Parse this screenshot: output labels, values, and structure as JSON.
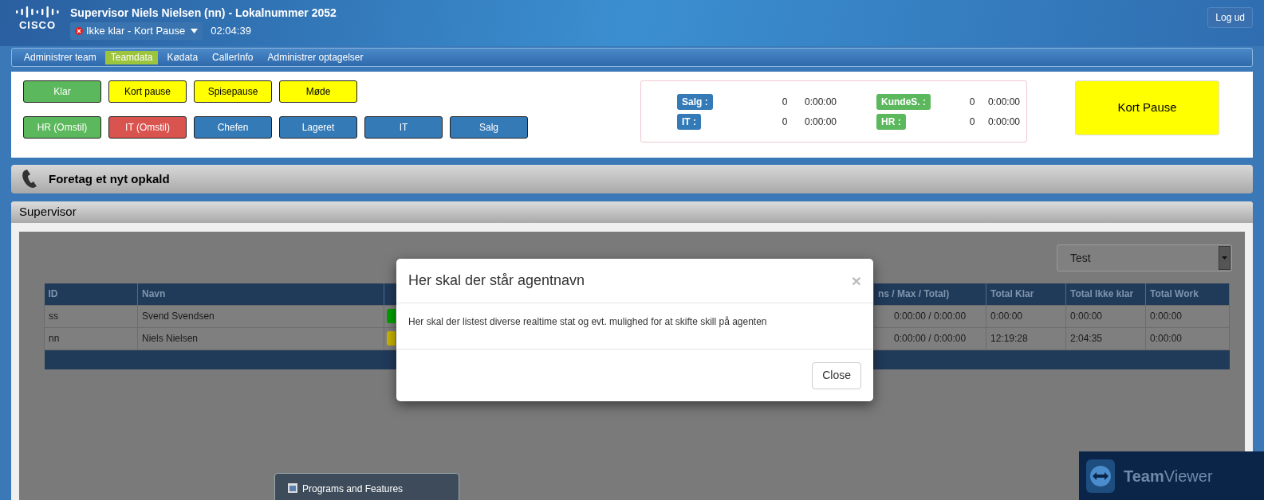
{
  "header": {
    "logo": "CISCO",
    "title": "Supervisor Niels Nielsen (nn) - Lokalnummer 2052",
    "status": "Ikke klar - Kort Pause",
    "timer": "02:04:39",
    "logout": "Log ud"
  },
  "nav": [
    {
      "label": "Administrer team",
      "selected": false
    },
    {
      "label": "Teamdata",
      "selected": true
    },
    {
      "label": "Kødata",
      "selected": false
    },
    {
      "label": "CallerInfo",
      "selected": false
    },
    {
      "label": "Administrer optagelser",
      "selected": false
    }
  ],
  "state_buttons": [
    [
      {
        "label": "Klar",
        "color": "#5cb85c"
      },
      {
        "label": "Kort pause",
        "color": "#ffff00"
      },
      {
        "label": "Spisepause",
        "color": "#ffff00"
      },
      {
        "label": "Møde",
        "color": "#ffff00"
      }
    ],
    [
      {
        "label": "HR (Omstil)",
        "color": "#5cb85c"
      },
      {
        "label": "IT (Omstil)",
        "color": "#d9534f"
      },
      {
        "label": "Chefen",
        "color": "#337ab7"
      },
      {
        "label": "Lageret",
        "color": "#337ab7"
      },
      {
        "label": "IT",
        "color": "#337ab7"
      },
      {
        "label": "Salg",
        "color": "#337ab7"
      }
    ]
  ],
  "queues": [
    {
      "label": "Salg :",
      "color": "#337ab7",
      "count": "0",
      "time": "0:00:00"
    },
    {
      "label": "KundeS. :",
      "color": "#5cb85c",
      "count": "0",
      "time": "0:00:00"
    },
    {
      "label": "IT :",
      "color": "#337ab7",
      "count": "0",
      "time": "0:00:00"
    },
    {
      "label": "HR :",
      "color": "#5cb85c",
      "count": "0",
      "time": "0:00:00"
    }
  ],
  "current_state": "Kort Pause",
  "call_bar": {
    "title": "Foretag et nyt opkald"
  },
  "supervisor": {
    "title": "Supervisor",
    "team_select": "Test",
    "columns": [
      {
        "kind": "text",
        "label": "ID"
      },
      {
        "kind": "text",
        "label": "Navn"
      },
      {
        "kind": "status"
      },
      {
        "kind": "text",
        "label": "ns / Max / Total)"
      },
      {
        "kind": "text",
        "label": "Total Klar"
      },
      {
        "kind": "text",
        "label": "Total Ikke klar"
      },
      {
        "kind": "text",
        "label": "Total Work"
      }
    ],
    "rows": [
      {
        "id": "ss",
        "name": "Svend Svendsen",
        "color": "#00a000",
        "calls": "0:00:00 / 0:00:00",
        "klar": "0:00:00",
        "ikke_klar": "0:00:00",
        "work": "0:00:00"
      },
      {
        "id": "nn",
        "name": "Niels Nielsen",
        "color": "#c8b400",
        "calls": "0:00:00 / 0:00:00",
        "klar": "12:19:28",
        "ikke_klar": "2:04:35",
        "work": "0:00:00"
      }
    ]
  },
  "modal": {
    "title": "Her skal der står agentnavn",
    "close_icon": "×",
    "body": "Her skal der listest diverse realtime stat og evt. mulighed for at skifte skill på agenten",
    "close_button": "Close"
  },
  "taskbar_popup": {
    "label": "Programs and Features"
  },
  "teamviewer": {
    "label": "**Team**Viewer"
  }
}
